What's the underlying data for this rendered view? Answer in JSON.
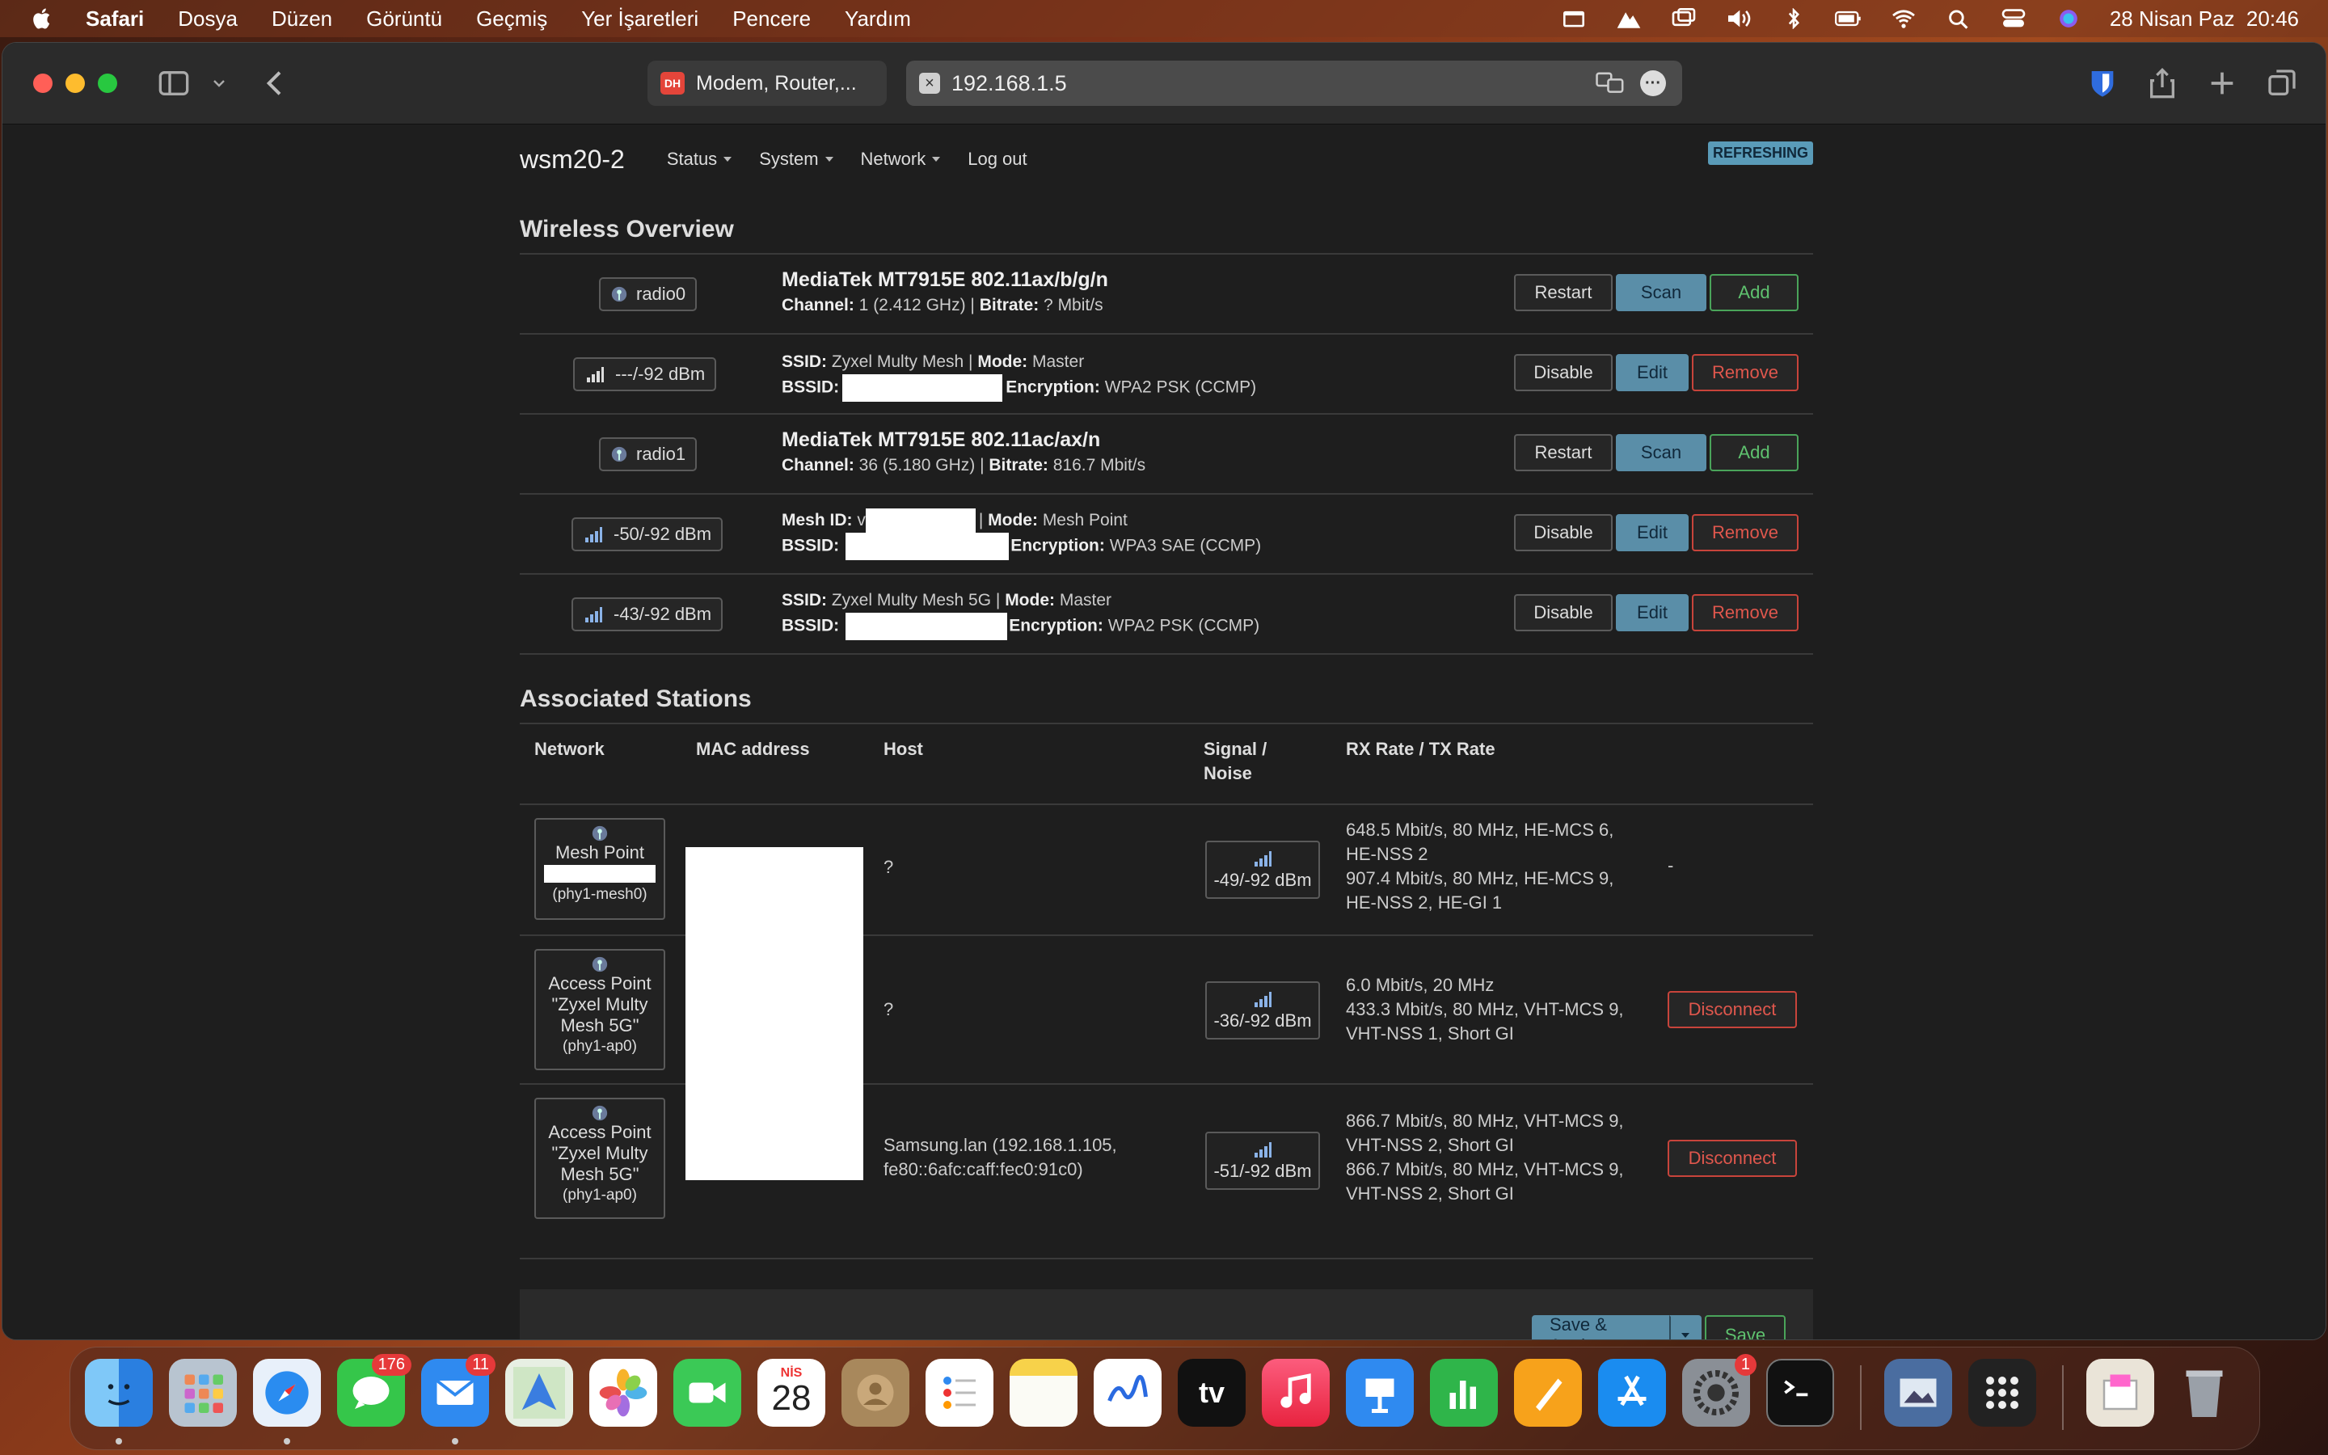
{
  "menubar": {
    "app": "Safari",
    "items": [
      "Dosya",
      "Düzen",
      "Görüntü",
      "Geçmiş",
      "Yer İşaretleri",
      "Pencere",
      "Yardım"
    ],
    "datetime": "28 Nisan Paz  20:46"
  },
  "browser": {
    "tab_inactive": "Modem, Router,...",
    "tab_inactive_favicon": "DH",
    "url": "192.168.1.5"
  },
  "nav": {
    "brand": "wsm20-2",
    "status": "Status",
    "system": "System",
    "network": "Network",
    "logout": "Log out",
    "badge": "REFRESHING"
  },
  "wireless": {
    "heading": "Wireless Overview",
    "buttons": {
      "restart": "Restart",
      "scan": "Scan",
      "add": "Add",
      "disable": "Disable",
      "edit": "Edit",
      "remove": "Remove"
    },
    "rows": [
      {
        "badge": "radio0",
        "title": "MediaTek MT7915E 802.11ax/b/g/n",
        "l2_label1": "Channel:",
        "l2_val1": " 1 (2.412 GHz) | ",
        "l2_label2": "Bitrate:",
        "l2_val2": " ? Mbit/s"
      },
      {
        "badge": "---/-92 dBm",
        "l1_label1": "SSID:",
        "l1_val1": " Zyxel Multy Mesh | ",
        "l1_label2": "Mode:",
        "l1_val2": " Master",
        "l2_label1": "BSSID:",
        "l2_label2": "Encryption:",
        "l2_val2": " WPA2 PSK (CCMP)"
      },
      {
        "badge": "radio1",
        "title": "MediaTek MT7915E 802.11ac/ax/n",
        "l2_label1": "Channel:",
        "l2_val1": " 36 (5.180 GHz) | ",
        "l2_label2": "Bitrate:",
        "l2_val2": " 816.7 Mbit/s"
      },
      {
        "badge": "-50/-92 dBm",
        "l1_label1": "Mesh ID:",
        "l1_val1": " v",
        "l1_sep": "| ",
        "l1_label2": "Mode:",
        "l1_val2": " Mesh Point",
        "l2_label1": "BSSID:",
        "l2_label2": "Encryption:",
        "l2_val2": " WPA3 SAE (CCMP)"
      },
      {
        "badge": "-43/-92 dBm",
        "l1_label1": "SSID:",
        "l1_val1": " Zyxel Multy Mesh 5G | ",
        "l1_label2": "Mode:",
        "l1_val2": " Master",
        "l2_label1": "BSSID:",
        "l2_label2": "Encryption:",
        "l2_val2": " WPA2 PSK (CCMP)"
      }
    ]
  },
  "stations": {
    "heading": "Associated Stations",
    "columns": {
      "network": "Network",
      "mac": "MAC address",
      "host": "Host",
      "signal1": "Signal /",
      "signal2": "Noise",
      "rate": "RX Rate / TX Rate"
    },
    "rows": [
      {
        "net1": "Mesh Point",
        "net_iface": "(phy1-mesh0)",
        "host": "?",
        "signal": "-49/-92 dBm",
        "rx1": "648.5 Mbit/s, 80 MHz, HE-MCS 6,",
        "rx2": "HE-NSS 2",
        "tx1": "907.4 Mbit/s, 80 MHz, HE-MCS 9,",
        "tx2": "HE-NSS 2, HE-GI 1",
        "action": "-"
      },
      {
        "net1": "Access Point",
        "net2": "\"Zyxel Multy",
        "net3": "Mesh 5G\"",
        "net_iface": "(phy1-ap0)",
        "host": "?",
        "signal": "-36/-92 dBm",
        "rx1": "6.0 Mbit/s, 20 MHz",
        "tx1": "433.3 Mbit/s, 80 MHz, VHT-MCS 9,",
        "tx2": "VHT-NSS 1, Short GI",
        "action": "Disconnect"
      },
      {
        "net1": "Access Point",
        "net2": "\"Zyxel Multy",
        "net3": "Mesh 5G\"",
        "net_iface": "(phy1-ap0)",
        "host1": "Samsung.lan (192.168.1.105,",
        "host2": "fe80::6afc:caff:fec0:91c0)",
        "signal": "-51/-92 dBm",
        "rx1": "866.7 Mbit/s, 80 MHz, VHT-MCS 9,",
        "rx2": "VHT-NSS 2, Short GI",
        "tx1": "866.7 Mbit/s, 80 MHz, VHT-MCS 9,",
        "tx2": "VHT-NSS 2, Short GI",
        "action": "Disconnect"
      }
    ]
  },
  "footer": {
    "save_apply": "Save & Apply",
    "save": "Save"
  },
  "dock": {
    "messages_badge": "176",
    "mail_badge": "11",
    "calendar_month": "NİS",
    "calendar_day": "28",
    "settings_badge": "1",
    "tv_label": "tv"
  },
  "colors": {
    "accent_blue": "#5a8ea8",
    "success_green": "#4aa45a",
    "danger_red": "#c8443b",
    "page_bg": "#1e1e1e"
  }
}
